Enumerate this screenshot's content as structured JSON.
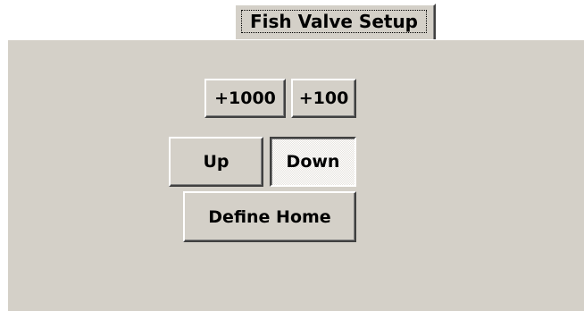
{
  "tabs": [
    {
      "label": "Fish Valve Setup",
      "selected": true
    }
  ],
  "buttons": {
    "plus_1000": {
      "label": "+1000"
    },
    "plus_100": {
      "label": "+100"
    },
    "up": {
      "label": "Up"
    },
    "down": {
      "label": "Down",
      "pressed": true
    },
    "define_home": {
      "label": "Define Home"
    }
  },
  "colors": {
    "face": "#d4d0c8",
    "highlight": "#ffffff",
    "shadow": "#808080",
    "dark_shadow": "#404040"
  }
}
